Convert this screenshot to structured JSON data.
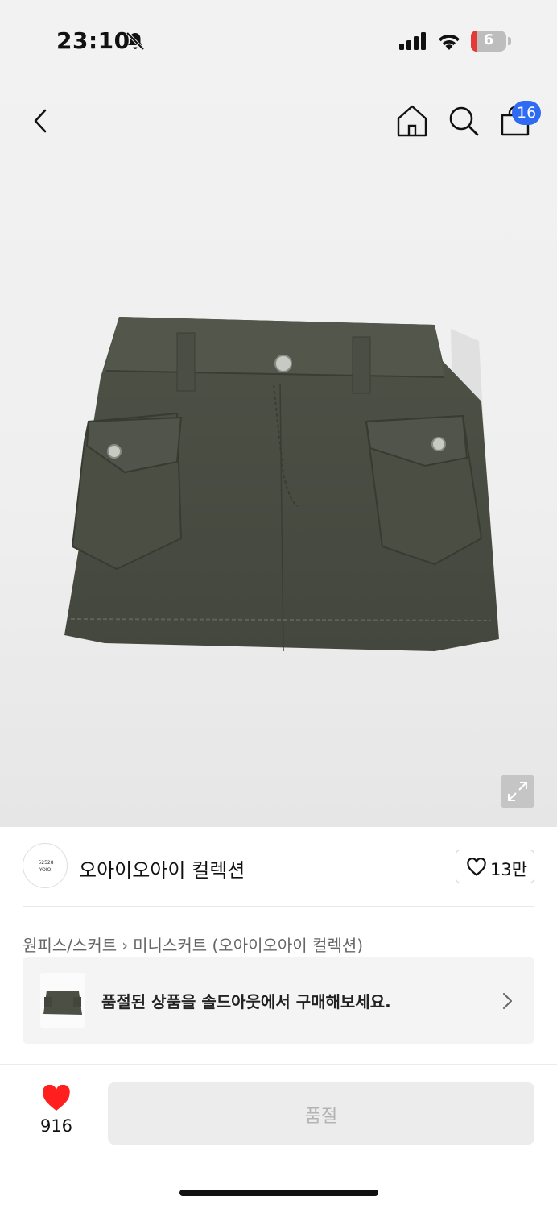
{
  "status_bar": {
    "time": "23:10",
    "battery_level": "6",
    "icons": [
      "bell-slash-icon",
      "cellular-signal-icon",
      "wifi-icon",
      "battery-icon"
    ]
  },
  "nav": {
    "icons": [
      "back-chevron-icon",
      "home-icon",
      "search-icon",
      "cart-icon"
    ],
    "cart_badge": "16"
  },
  "product": {
    "image": "olive-cargo-mini-skirt",
    "expand_icon": "expand-arrows-icon"
  },
  "brand": {
    "logo_line1": "52528",
    "logo_line2": "YOIOI",
    "name": "오아이오아이 컬렉션",
    "like_count": "13만"
  },
  "breadcrumb": {
    "category": "원피스/스커트",
    "subcategory": "미니스커트 (오아이오아이 컬렉션)"
  },
  "soldout_banner": {
    "message": "품절된 상품을 솔드아웃에서 구매해보세요."
  },
  "bottom_bar": {
    "favorite_count": "916",
    "buy_label": "품절"
  },
  "colors": {
    "accent": "#2f6bf2",
    "heart": "#ff1f1f",
    "disabled_bg": "#ececec",
    "disabled_text": "#b3b3b3"
  }
}
